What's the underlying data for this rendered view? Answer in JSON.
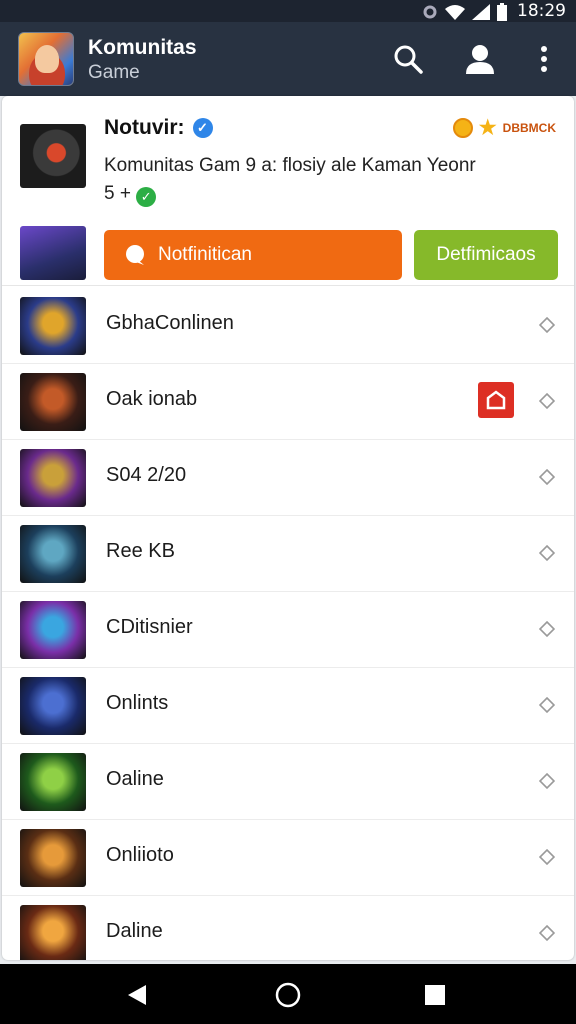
{
  "status_bar": {
    "time": "18:29"
  },
  "app_bar": {
    "title": "Komunitas",
    "subtitle": "Game"
  },
  "header": {
    "title": "Notuvir:",
    "badge_label": "DBBMCK",
    "description": "Komunitas Gam 9 a: flosiy ale Kaman Yeonr",
    "description_suffix": "5 +"
  },
  "actions": {
    "primary_label": "Notfinitican",
    "secondary_label": "Detfimicaos"
  },
  "list": [
    {
      "label": "GbhaConlinen",
      "thumb_colors": [
        "#2b3c8a",
        "#e0a52b"
      ],
      "tagged": false
    },
    {
      "label": "Oak ionab",
      "thumb_colors": [
        "#3a1d16",
        "#c35a28"
      ],
      "tagged": true
    },
    {
      "label": "S04 2/20",
      "thumb_colors": [
        "#6a2a8c",
        "#c9a03a"
      ],
      "tagged": false
    },
    {
      "label": "Ree KB",
      "thumb_colors": [
        "#1c3f5c",
        "#5fa7c2"
      ],
      "tagged": false
    },
    {
      "label": "CDitisnier",
      "thumb_colors": [
        "#7a2fa8",
        "#3aa6e0"
      ],
      "tagged": false
    },
    {
      "label": "Onlints",
      "thumb_colors": [
        "#1a2a6a",
        "#4c6fd1"
      ],
      "tagged": false
    },
    {
      "label": "Oaline",
      "thumb_colors": [
        "#1e5a1c",
        "#8fd046"
      ],
      "tagged": false
    },
    {
      "label": "Onliioto",
      "thumb_colors": [
        "#5a2e14",
        "#e69a3a"
      ],
      "tagged": false
    },
    {
      "label": "Daline",
      "thumb_colors": [
        "#6a2a14",
        "#f0a640"
      ],
      "tagged": false
    }
  ]
}
